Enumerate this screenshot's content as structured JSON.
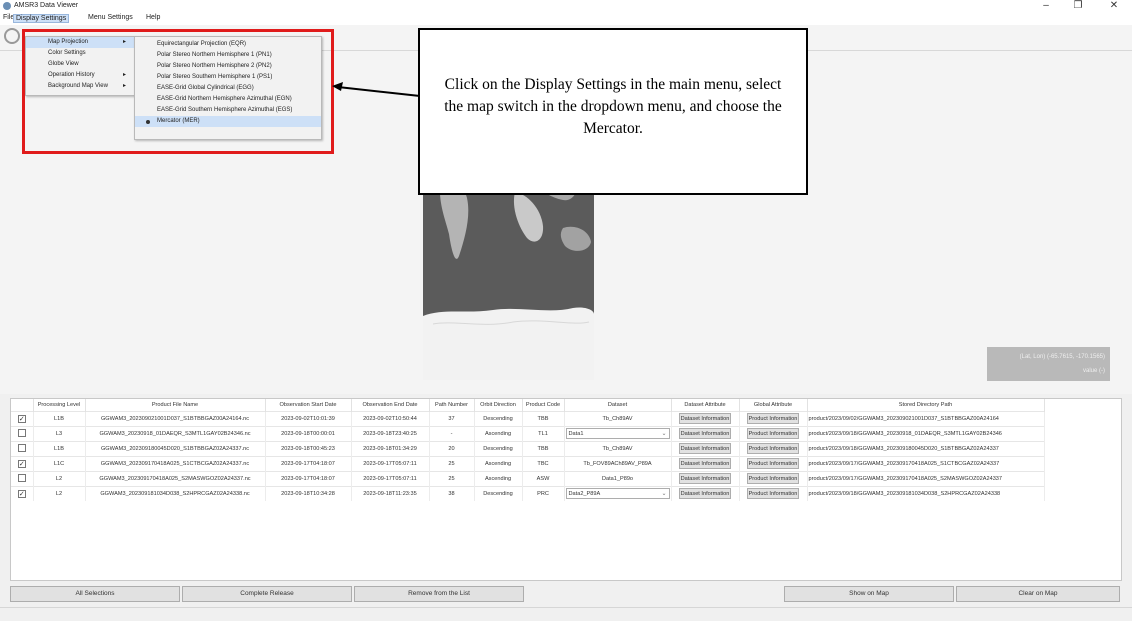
{
  "window": {
    "title": "AMSR3 Data Viewer",
    "minimize_glyph": "–",
    "maximize_glyph": "❐",
    "close_glyph": "✕"
  },
  "menubar": {
    "items": [
      {
        "label": "File"
      },
      {
        "label": "Display Settings"
      },
      {
        "label": "Menu Settings"
      },
      {
        "label": "Help"
      }
    ]
  },
  "display_menu": {
    "items": [
      {
        "label": "Map Projection",
        "submenu": true,
        "selected": true
      },
      {
        "label": "Color Settings",
        "submenu": false
      },
      {
        "label": "Globe View",
        "submenu": false
      },
      {
        "label": "Operation History",
        "submenu": true
      },
      {
        "label": "Background Map View",
        "submenu": true
      }
    ],
    "arrow_glyph": "▸"
  },
  "projection_menu": {
    "items": [
      {
        "label": "Equirectangular Projection (EQR)"
      },
      {
        "label": "Polar Stereo Northern Hemisphere 1 (PN1)"
      },
      {
        "label": "Polar Stereo Northern Hemisphere 2 (PN2)"
      },
      {
        "label": "Polar Stereo Southern Hemisphere 1 (PS1)"
      },
      {
        "label": "EASE-Grid Global Cylindrical (EGG)"
      },
      {
        "label": "EASE-Grid Northern Hemisphere Azimuthal (EGN)"
      },
      {
        "label": "EASE-Grid Southern Hemisphere Azimuthal (EGS)"
      },
      {
        "label": "Mercator (MER)",
        "selected": true
      }
    ]
  },
  "callout": {
    "text": "Click on the Display Settings in the main menu, select the map switch in the dropdown menu, and choose the Mercator."
  },
  "coord_readout": {
    "latlon": "(Lat, Lon) (-65.7615, -170.1565)",
    "value": "value (-)"
  },
  "table": {
    "headers": [
      "",
      "Processing Level",
      "Product File Name",
      "Observation Start Date",
      "Observation End Date",
      "Path Number",
      "Orbit Direction",
      "Product Code",
      "Dataset",
      "Dataset Attribute",
      "Global Attribute",
      "Stored Directory Path"
    ],
    "rows": [
      {
        "checked": true,
        "level": "L1B",
        "file": "GGWAM3_202309021001D037_S1BTBBGAZ00A24164.nc",
        "start": "2023-09-02T10:01:39",
        "end": "2023-09-02T10:50:44",
        "path": "37",
        "orbit": "Descending",
        "code": "TBB",
        "dataset": "Tb_Ch89AV",
        "dataset_combo": false,
        "ds_attr": "Dataset Information",
        "gl_attr": "Product Information",
        "dir": "product/2023/09/02/GGWAM3_202309021001D037_S1BTBBGAZ00A24164"
      },
      {
        "checked": false,
        "level": "L3",
        "file": "GGWAM3_20230918_01DAEQR_S3MTL1GAY02B24346.nc",
        "start": "2023-09-18T00:00:01",
        "end": "2023-09-18T23:40:25",
        "path": "-",
        "orbit": "Ascending",
        "code": "TL1",
        "dataset": "Data1",
        "dataset_combo": true,
        "ds_attr": "Dataset Information",
        "gl_attr": "Product Information",
        "dir": "product/2023/09/18/GGWAM3_20230918_01DAEQR_S3MTL1GAY02B24346"
      },
      {
        "checked": false,
        "level": "L1B",
        "file": "GGWAM3_202309180045D020_S1BTBBGAZ02A24337.nc",
        "start": "2023-09-18T00:45:23",
        "end": "2023-09-18T01:34:29",
        "path": "20",
        "orbit": "Descending",
        "code": "TBB",
        "dataset": "Tb_Ch89AV",
        "dataset_combo": false,
        "ds_attr": "Dataset Information",
        "gl_attr": "Product Information",
        "dir": "product/2023/09/18/GGWAM3_202309180045D020_S1BTBBGAZ02A24337"
      },
      {
        "checked": true,
        "level": "L1C",
        "file": "GGWAM3_202309170418A025_S1CTBCGAZ02A24337.nc",
        "start": "2023-09-17T04:18:07",
        "end": "2023-09-17T05:07:11",
        "path": "25",
        "orbit": "Ascending",
        "code": "TBC",
        "dataset": "Tb_FOV89ACh89AV_P89A",
        "dataset_combo": false,
        "ds_attr": "Dataset Information",
        "gl_attr": "Product Information",
        "dir": "product/2023/09/17/GGWAM3_202309170418A025_S1CTBCGAZ02A24337"
      },
      {
        "checked": false,
        "level": "L2",
        "file": "GGWAM3_202309170418A025_S2MASWGOZ02A24337.nc",
        "start": "2023-09-17T04:18:07",
        "end": "2023-09-17T05:07:11",
        "path": "25",
        "orbit": "Ascending",
        "code": "ASW",
        "dataset": "Data1_P89o",
        "dataset_combo": false,
        "ds_attr": "Dataset Information",
        "gl_attr": "Product Information",
        "dir": "product/2023/09/17/GGWAM3_202309170418A025_S2MASWGOZ02A24337"
      },
      {
        "checked": true,
        "level": "L2",
        "file": "GGWAM3_202309181034D038_S2HPRCGAZ02A24338.nc",
        "start": "2023-09-18T10:34:28",
        "end": "2023-09-18T11:23:35",
        "path": "38",
        "orbit": "Descending",
        "code": "PRC",
        "dataset": "Data2_P89A",
        "dataset_combo": true,
        "ds_attr": "Dataset Information",
        "gl_attr": "Product Information",
        "dir": "product/2023/09/18/GGWAM3_202309181034D038_S2HPRCGAZ02A24338"
      }
    ],
    "combo_chevron": "⌄",
    "check_glyph": "✓"
  },
  "buttons": {
    "all_selections": "All Selections",
    "complete_release": "Complete Release",
    "remove_from_list": "Remove from the List",
    "show_on_map": "Show on Map",
    "clear_on_map": "Clear on Map"
  },
  "colors": {
    "highlight": "#e01b1b",
    "selection": "#cde0f7"
  }
}
